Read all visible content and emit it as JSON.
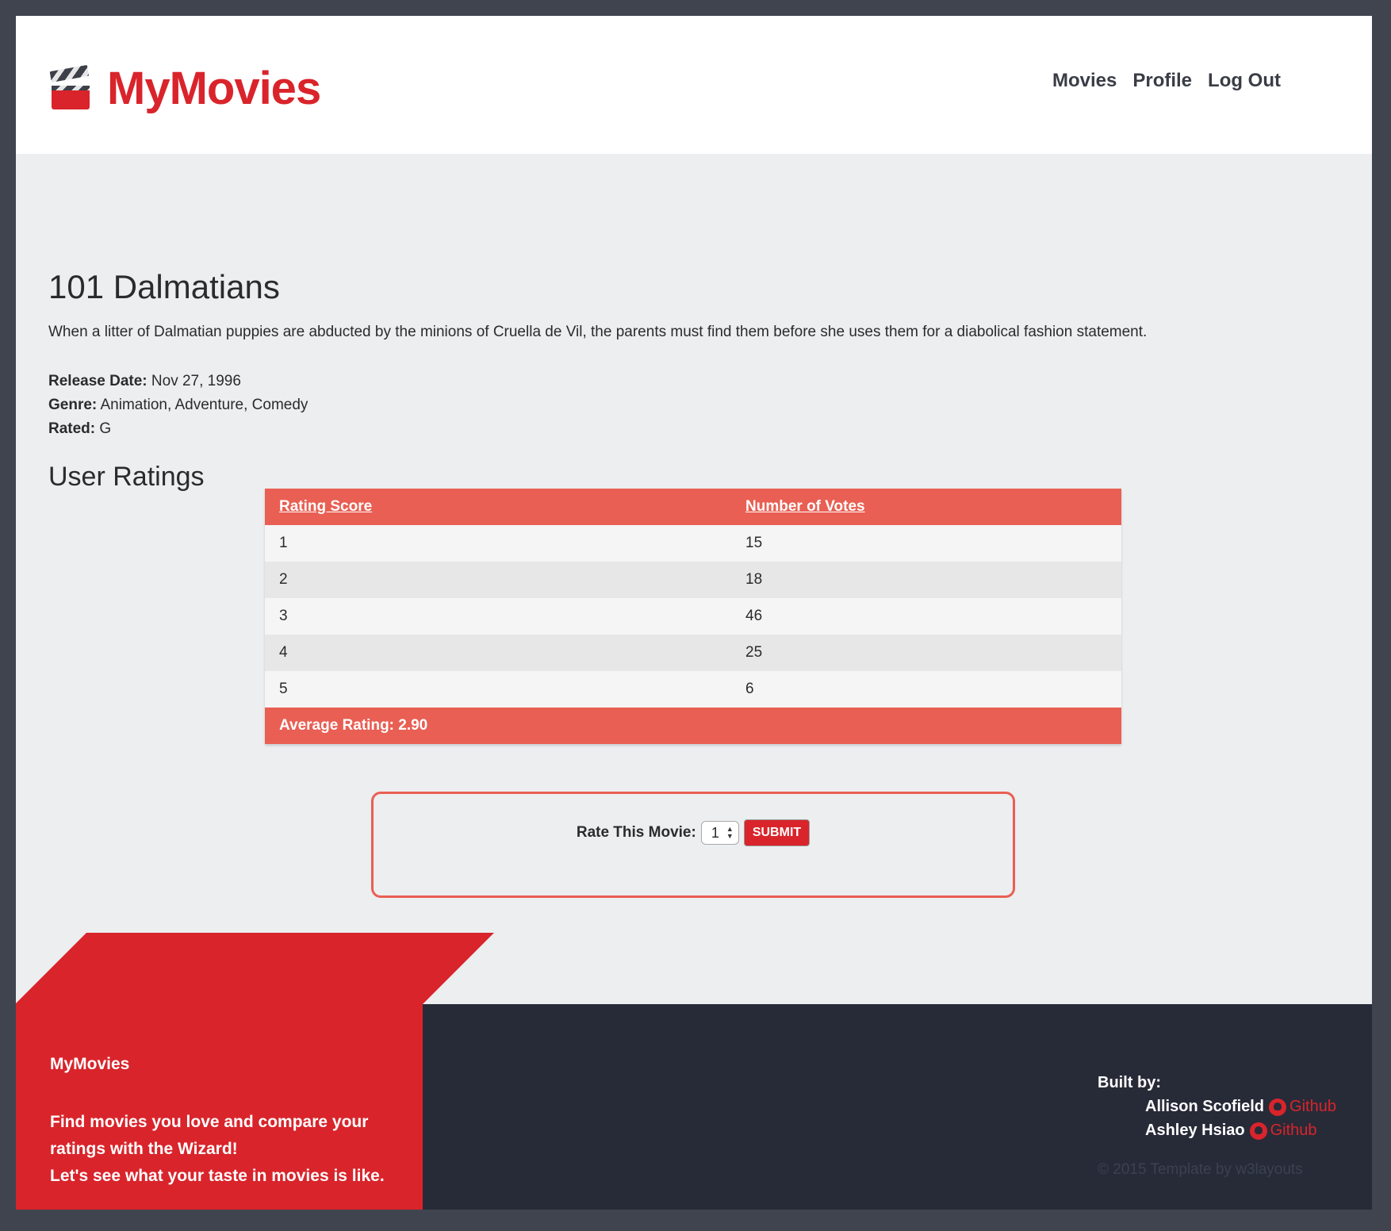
{
  "header": {
    "logo_text": "MyMovies",
    "nav": [
      "Movies",
      "Profile",
      "Log Out"
    ]
  },
  "movie": {
    "title": "101 Dalmatians",
    "description": "When a litter of Dalmatian puppies are abducted by the minions of Cruella de Vil, the parents must find them before she uses them for a diabolical fashion statement.",
    "release_label": "Release Date:",
    "release_value": "Nov 27, 1996",
    "genre_label": "Genre:",
    "genre_value": "Animation, Adventure, Comedy",
    "rated_label": "Rated:",
    "rated_value": "G"
  },
  "ratings": {
    "heading": "User Ratings",
    "headers": [
      "Rating Score",
      "Number of Votes"
    ],
    "rows": [
      [
        "1",
        "15"
      ],
      [
        "2",
        "18"
      ],
      [
        "3",
        "46"
      ],
      [
        "4",
        "25"
      ],
      [
        "5",
        "6"
      ]
    ],
    "average": "Average Rating: 2.90"
  },
  "rate_form": {
    "label": "Rate This Movie:",
    "selected": "1",
    "submit_label": "SUBMIT"
  },
  "footer": {
    "brand": "MyMovies",
    "tagline_1": "Find movies you love and compare your ratings with the Wizard!",
    "tagline_2": "Let's see what your taste in movies is like.",
    "built_by": "Built by:",
    "builders": [
      {
        "name": "Allison Scofield",
        "link": "Github"
      },
      {
        "name": "Ashley Hsiao",
        "link": "Github"
      }
    ],
    "copyright": "© 2015 Template by w3layouts"
  },
  "colors": {
    "brand_red": "#d9242b",
    "table_red": "#e95f53",
    "footer_dark": "#272b38"
  }
}
